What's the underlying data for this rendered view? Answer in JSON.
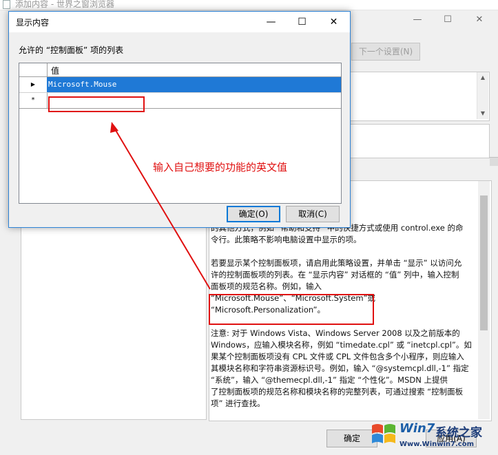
{
  "background_window": {
    "title": "添加内容 - 世界之窗浏览器",
    "next_setting_button": "下一个设置(N)",
    "help_text": "“开始”屏幕中显示的控制面板项(\n控制面板中仅显示在此设置中指\n“控制面板”，以及访问控制面板项\n的其他方式，例如 “帮助和支持” 中的快捷方式或使用 control.exe 的命\n令行。此策略不影响电脑设置中显示的项。\n\n若要显示某个控制面板项，请启用此策略设置，并单击 “显示” 以访问允\n许的控制面板项的列表。在 “显示内容” 对话框的 “值” 列中，输入控制\n面板项的规范名称。例如，输入\n“Microsoft.Mouse”、“Microsoft.System”或\n“Microsoft.Personalization”。\n\n注意: 对于 Windows Vista、Windows Server 2008 以及之前版本的\nWindows，应输入模块名称，例如 “timedate.cpl” 或 “inetcpl.cpl”。如\n果某个控制面板项没有 CPL 文件或 CPL 文件包含多个小程序，则应输入\n其模块名称和字符串资源标识号。例如，输入 “@systemcpl.dll,-1” 指定\n“系统”，输入 “@themecpl.dll,-1” 指定 “个性化”。MSDN 上提供\n了控制面板项的规范名称和模块名称的完整列表，可通过搜索 “控制面板\n项” 进行查找。",
    "ok_button": "确定",
    "apply_button": "应用(A)"
  },
  "dialog": {
    "title": "显示内容",
    "label": "允许的 “控制面板” 项的列表",
    "column_header": "值",
    "rows": [
      "Microsoft.Mouse"
    ],
    "new_row_marker": "*",
    "ok_button": "确定(O)",
    "cancel_button": "取消(C)"
  },
  "annotation": {
    "text": "输入自己想要的功能的英文值",
    "color": "#e01010"
  },
  "watermark": {
    "brand": "系统之家",
    "logo_text": "Win7",
    "url": "Www.Winwin7.com"
  },
  "colors": {
    "selection": "#1f79d6",
    "dialog_border": "#2c82d6",
    "annotation": "#e01010"
  }
}
